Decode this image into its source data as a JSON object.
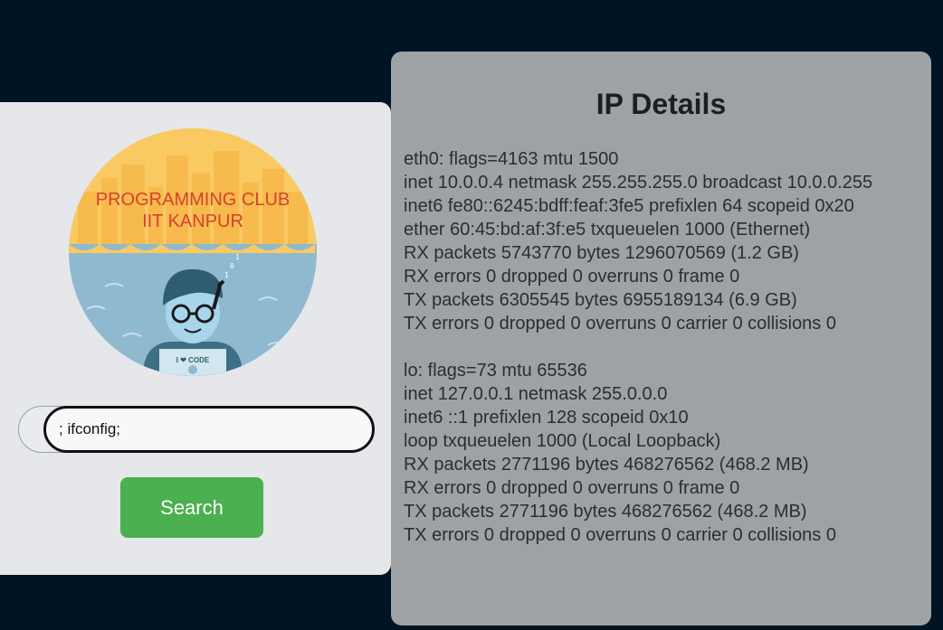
{
  "logo": {
    "line1": "PROGRAMMING CLUB",
    "line2": "IIT KANPUR",
    "shirt_text": "I ❤ CODE"
  },
  "search": {
    "value": "; ifconfig;",
    "button_label": "Search"
  },
  "panel": {
    "title": "IP Details",
    "blocks": [
      [
        "eth0: flags=4163 mtu 1500",
        "inet 10.0.0.4 netmask 255.255.255.0 broadcast 10.0.0.255",
        "inet6 fe80::6245:bdff:feaf:3fe5 prefixlen 64 scopeid 0x20",
        "ether 60:45:bd:af:3f:e5 txqueuelen 1000 (Ethernet)",
        "RX packets 5743770 bytes 1296070569 (1.2 GB)",
        "RX errors 0 dropped 0 overruns 0 frame 0",
        "TX packets 6305545 bytes 6955189134 (6.9 GB)",
        "TX errors 0 dropped 0 overruns 0 carrier 0 collisions 0"
      ],
      [
        "lo: flags=73 mtu 65536",
        "inet 127.0.0.1 netmask 255.0.0.0",
        "inet6 ::1 prefixlen 128 scopeid 0x10",
        "loop txqueuelen 1000 (Local Loopback)",
        "RX packets 2771196 bytes 468276562 (468.2 MB)",
        "RX errors 0 dropped 0 overruns 0 frame 0",
        "TX packets 2771196 bytes 468276562 (468.2 MB)",
        "TX errors 0 dropped 0 overruns 0 carrier 0 collisions 0"
      ]
    ]
  }
}
